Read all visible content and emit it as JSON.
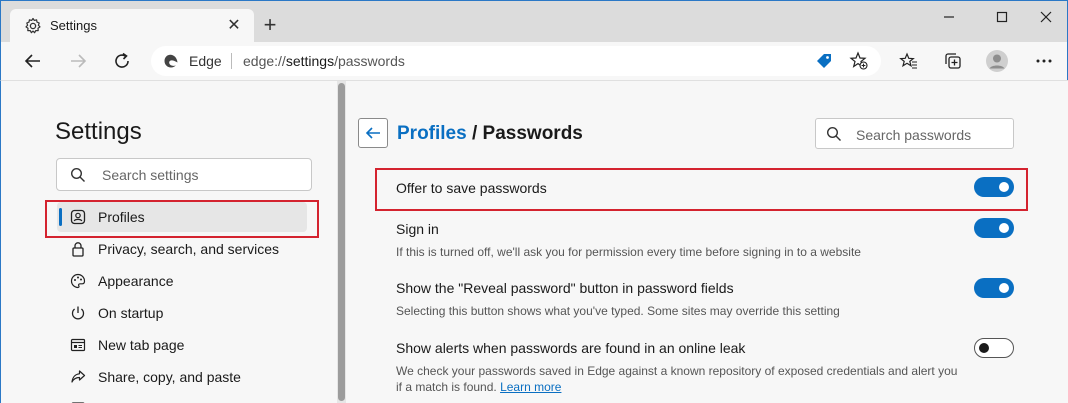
{
  "window": {
    "tab_title": "Settings",
    "close_tab_glyph": "✕",
    "new_tab_glyph": "+"
  },
  "address_bar": {
    "site_label": "Edge",
    "url_scheme": "edge://",
    "url_host": "settings",
    "url_path": "/passwords"
  },
  "sidebar": {
    "title": "Settings",
    "search_placeholder": "Search settings",
    "items": [
      {
        "label": "Profiles",
        "icon": "profile-icon",
        "active": true
      },
      {
        "label": "Privacy, search, and services",
        "icon": "lock-icon"
      },
      {
        "label": "Appearance",
        "icon": "appearance-icon"
      },
      {
        "label": "On startup",
        "icon": "power-icon"
      },
      {
        "label": "New tab page",
        "icon": "newtab-icon"
      },
      {
        "label": "Share, copy, and paste",
        "icon": "share-icon"
      }
    ]
  },
  "main": {
    "breadcrumb_parent": "Profiles",
    "breadcrumb_separator": "/",
    "breadcrumb_current": "Passwords",
    "search_placeholder": "Search passwords",
    "settings": [
      {
        "title": "Offer to save passwords",
        "desc": "",
        "enabled": true
      },
      {
        "title": "Sign in",
        "desc": "If this is turned off, we'll ask you for permission every time before signing in to a website",
        "enabled": true
      },
      {
        "title": "Show the \"Reveal password\" button in password fields",
        "desc": "Selecting this button shows what you've typed. Some sites may override this setting",
        "enabled": true
      },
      {
        "title": "Show alerts when passwords are found in an online leak",
        "desc": "We check your passwords saved in Edge against a known repository of exposed credentials and alert you if a match is found.",
        "link": "Learn more",
        "enabled": false
      }
    ]
  },
  "colors": {
    "accent": "#0a6fc2",
    "highlight_box": "#d4232f"
  }
}
